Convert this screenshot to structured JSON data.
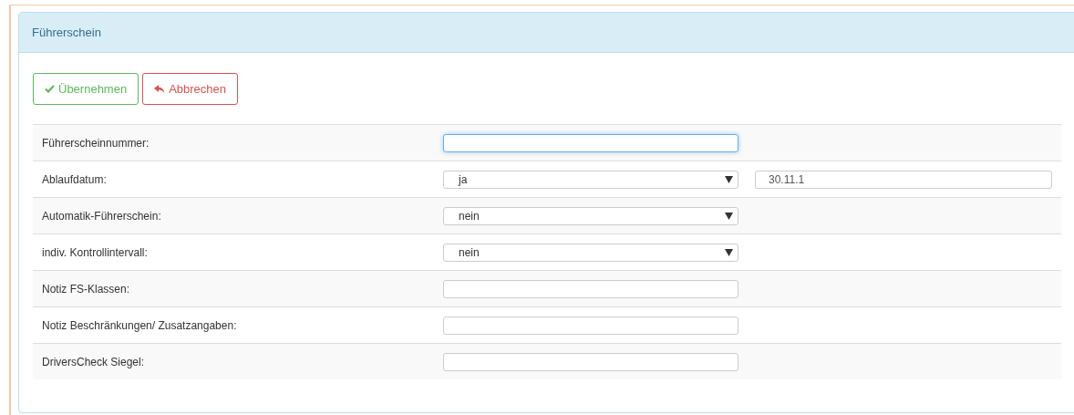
{
  "panel": {
    "title": "Führerschein"
  },
  "buttons": [
    {
      "kind": "apply",
      "label": "Übernehmen"
    },
    {
      "kind": "cancel",
      "label": "Abbrechen"
    }
  ],
  "rows": [
    {
      "kind": "text",
      "label": "Führerscheinnummer:",
      "focused": true
    },
    {
      "kind": "select",
      "label": "Ablaufdatum:",
      "value": "ja",
      "extra_value": "30.11.1"
    },
    {
      "kind": "select",
      "label": "Automatik-Führerschein:",
      "value": "nein"
    },
    {
      "kind": "select",
      "label": "indiv. Kontrollintervall:",
      "value": "nein"
    },
    {
      "kind": "text",
      "label": "Notiz FS-Klassen:",
      "focused": false
    },
    {
      "kind": "text",
      "label": "Notiz Beschränkungen/ Zusatzangaben:",
      "focused": false
    },
    {
      "kind": "text",
      "label": "DriversCheck Siegel:",
      "focused": false
    }
  ]
}
